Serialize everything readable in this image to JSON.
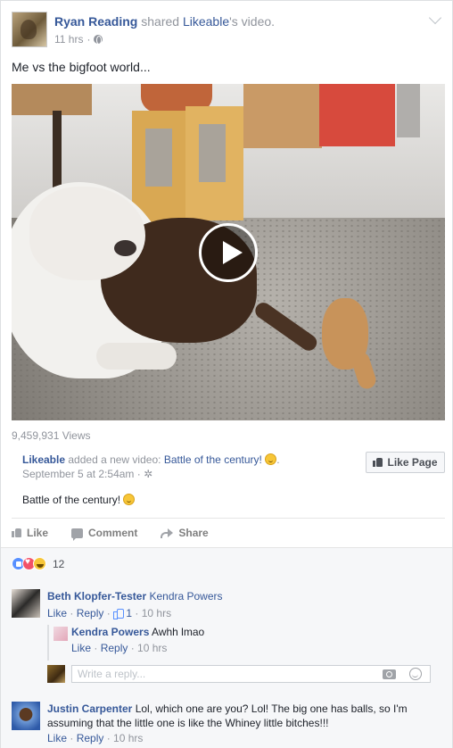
{
  "post": {
    "author": "Ryan Reading",
    "action": "shared",
    "shared_from": "Likeable",
    "shared_suffix": "'s video.",
    "time": "11 hrs",
    "privacy_icon": "globe-icon",
    "text": "Me vs the bigfoot world...",
    "views": "9,459,931 Views"
  },
  "shared": {
    "page_name": "Likeable",
    "added_text": "added a new video:",
    "video_title": "Battle of the century!",
    "period": ".",
    "date": "September 5 at 2:54am",
    "description": "Battle of the century!",
    "like_page_label": "Like Page"
  },
  "actions": {
    "like": "Like",
    "comment": "Comment",
    "share": "Share"
  },
  "reactions": {
    "count": "12",
    "types": [
      "like-icon",
      "love-icon",
      "haha-icon"
    ]
  },
  "comments": [
    {
      "author": "Beth Klopfer-Tester",
      "text": "Kendra Powers",
      "like": "Like",
      "reply": "Reply",
      "likes": "1",
      "time": "10 hrs",
      "reply_comment": {
        "author": "Kendra Powers",
        "text": "Awhh lmao",
        "like": "Like",
        "reply": "Reply",
        "time": "10 hrs"
      }
    },
    {
      "author": "Justin Carpenter",
      "text": "Lol, which one are you? Lol! The big one has balls, so I'm assuming that the little one is like the Whiney little bitches!!!",
      "like": "Like",
      "reply": "Reply",
      "time": "10 hrs"
    }
  ],
  "reply_box": {
    "placeholder": "Write a reply..."
  },
  "colors": {
    "link": "#365899",
    "meta": "#90949c",
    "comment_bg": "#f6f7f9"
  }
}
